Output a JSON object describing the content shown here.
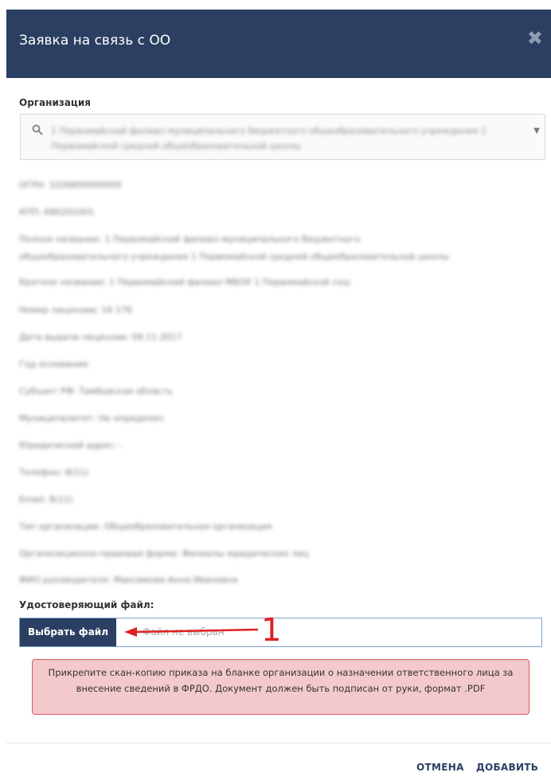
{
  "modal": {
    "title": "Заявка на связь с ОО",
    "close_icon": "close-icon"
  },
  "organization": {
    "label": "Организация",
    "selected_value": "1 Первомайский филиал муниципального бюджетного общеобразовательного учреждения 1 Первомайской средней общеобразовательной школы"
  },
  "info_lines": [
    "ОГРН: 1026800000000",
    "КПП: 680201001",
    "Полное название: 1 Первомайский филиал муниципального бюджетного",
    "общеобразовательного учреждения 1 Первомайской средней общеобразовательной школы",
    "Краткое название: 1 Первомайский филиал МБОУ 1 Первомайской сош",
    "Номер лицензии: 16 176",
    "Дата выдачи лицензии: 09.11.2017",
    "Год основания:",
    "Субъект РФ: Тамбовская область",
    "Муниципалитет: Не определен",
    "Юридический адрес: -",
    "Телефон: 8(11)",
    "Email: 8(11)",
    "Тип организации: Общеобразовательная организация",
    "Организационно-правовая форма: Филиалы юридических лиц",
    "ФИО руководителя: Максимова Анна Ивановна"
  ],
  "file_upload": {
    "label": "Удостоверяющий файл:",
    "button_label": "Выбрать файл",
    "status_text": "Файл не выбран",
    "annotation_number": "1"
  },
  "alert": {
    "text": "Прикрепите скан-копию приказа на бланке организации о назначении ответственного лица за внесение сведений в ФРДО. Документ должен быть подписан от руки, формат .PDF"
  },
  "footer": {
    "cancel_label": "ОТМЕНА",
    "add_label": "ДОБАВИТЬ"
  },
  "colors": {
    "header_bg": "#2a3f62",
    "alert_bg": "#f3c9cc",
    "alert_border": "#d9585f",
    "annotation": "#e02020"
  }
}
